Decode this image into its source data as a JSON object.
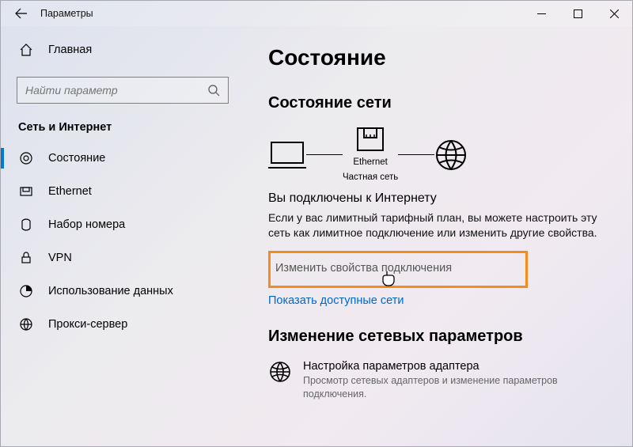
{
  "window": {
    "title": "Параметры"
  },
  "sidebar": {
    "home": "Главная",
    "search_placeholder": "Найти параметр",
    "section": "Сеть и Интернет",
    "items": [
      {
        "label": "Состояние"
      },
      {
        "label": "Ethernet"
      },
      {
        "label": "Набор номера"
      },
      {
        "label": "VPN"
      },
      {
        "label": "Использование данных"
      },
      {
        "label": "Прокси-сервер"
      }
    ]
  },
  "page": {
    "title": "Состояние",
    "network_status_title": "Состояние сети",
    "diagram": {
      "center_label_top": "Ethernet",
      "center_label_bottom": "Частная сеть"
    },
    "connected_title": "Вы подключены к Интернету",
    "connected_text": "Если у вас лимитный тарифный план, вы можете настроить эту сеть как лимитное подключение или изменить другие свойства.",
    "change_props_link": "Изменить свойства подключения",
    "show_networks_link": "Показать доступные сети",
    "change_net_title": "Изменение сетевых параметров",
    "adapter": {
      "title": "Настройка параметров адаптера",
      "desc": "Просмотр сетевых адаптеров и изменение параметров подключения."
    }
  }
}
